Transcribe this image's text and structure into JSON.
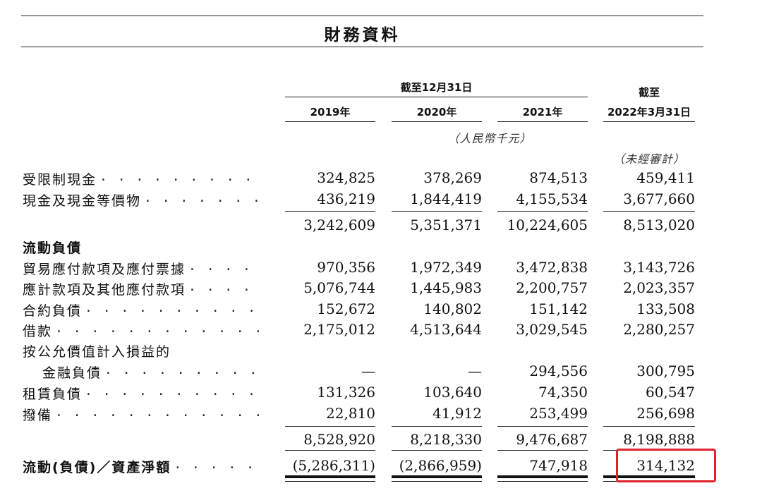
{
  "title": "財務資料",
  "header": {
    "period_group": "截至12月31日",
    "years": [
      "2019年",
      "2020年",
      "2021年"
    ],
    "last_col_top": "截至",
    "last_col_bottom": "2022年3月31日",
    "currency_note": "（人民幣千元）",
    "unaudited_note": "（未經審計）"
  },
  "rows": [
    {
      "label": "受限制現金",
      "dots": ". . . . . . . . . . . . . . . .",
      "values": [
        "324,825",
        "378,269",
        "874,513",
        "459,411"
      ]
    },
    {
      "label": "現金及現金等價物",
      "dots": ". . . . . . . . . . . .",
      "values": [
        "436,219",
        "1,844,419",
        "4,155,534",
        "3,677,660"
      ]
    },
    {
      "label": "",
      "dots": "",
      "values": [
        "3,242,609",
        "5,351,371",
        "10,224,605",
        "8,513,020"
      ]
    },
    {
      "label": "流動負債",
      "dots": "",
      "values": [
        "",
        "",
        "",
        ""
      ]
    },
    {
      "label": "貿易應付款項及應付票據",
      "dots": ". . . . .",
      "values": [
        "970,356",
        "1,972,349",
        "3,472,838",
        "3,143,726"
      ]
    },
    {
      "label": "應計款項及其他應付款項",
      "dots": ". . . . .",
      "values": [
        "5,076,744",
        "1,445,983",
        "2,200,757",
        "2,023,357"
      ]
    },
    {
      "label": "合約負債",
      "dots": ". . . . . . . . . . . . . . . . .",
      "values": [
        "152,672",
        "140,802",
        "151,142",
        "133,508"
      ]
    },
    {
      "label": "借款",
      "dots": ". . . . . . . . . . . . . . . . . . . . .",
      "values": [
        "2,175,012",
        "4,513,644",
        "3,029,545",
        "2,280,257"
      ]
    },
    {
      "label": "按公允價值計入損益的",
      "dots": "",
      "values": [
        "",
        "",
        "",
        ""
      ]
    },
    {
      "label": "金融負債",
      "dots": ". . . . . . . . . . . . . . .",
      "values": [
        "—",
        "—",
        "294,556",
        "300,795"
      ]
    },
    {
      "label": "租賃負債",
      "dots": ". . . . . . . . . . . . . . . . .",
      "values": [
        "131,326",
        "103,640",
        "74,350",
        "60,547"
      ]
    },
    {
      "label": "撥備",
      "dots": ". . . . . . . . . . . . . . . . . . . . .",
      "values": [
        "22,810",
        "41,912",
        "253,499",
        "256,698"
      ]
    },
    {
      "label": "",
      "dots": "",
      "values": [
        "8,528,920",
        "8,218,330",
        "9,476,687",
        "8,198,888"
      ]
    },
    {
      "label": "流動(負債)／資產淨額",
      "dots": ". . . . . . .",
      "values": [
        "(5,286,311)",
        "(2,866,959)",
        "747,918",
        "314,132"
      ]
    }
  ],
  "highlight_color": "#e0202a"
}
